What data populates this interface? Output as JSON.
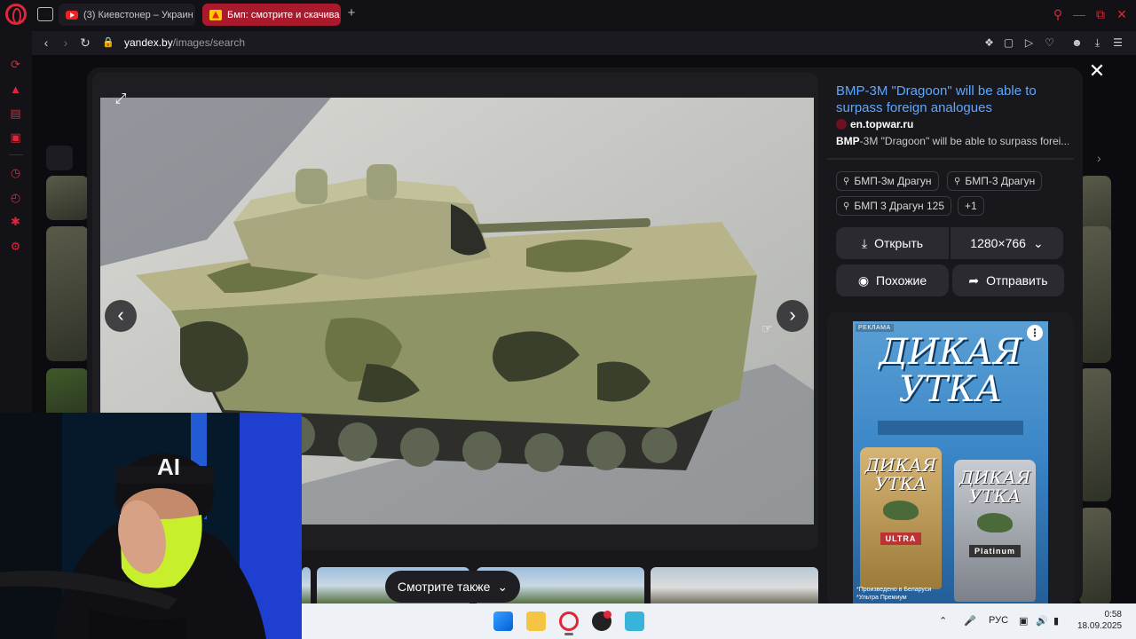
{
  "browser": {
    "tabs": [
      {
        "label": "(3) Киевстонер – Украин",
        "active": false
      },
      {
        "label": "Бмп: смотрите и скачива",
        "active": true
      }
    ],
    "address": {
      "domain": "yandex.by",
      "path": "/images/search"
    }
  },
  "viewer": {
    "title": "BMP-3M \"Dragoon\" will be able to surpass foreign analogues",
    "source": "en.topwar.ru",
    "snippet_bold": "BMP",
    "snippet_rest": "-3M \"Dragoon\" will be able to surpass forei...",
    "chips": [
      "БМП-3м Драгун",
      "БМП-3 Драгун",
      "БМП 3 Драгун 125",
      "+1"
    ],
    "open_label": "Открыть",
    "size_label": "1280×766",
    "similar_label": "Похожие",
    "share_label": "Отправить",
    "see_also_label": "Смотрите также"
  },
  "ad": {
    "badge": "РЕКЛАМА",
    "title_line1": "ДИКАЯ",
    "title_line2": "УТКА",
    "bottle1_line1": "ДИКАЯ",
    "bottle1_line2": "УТКА",
    "bottle1_sub": "ULTRA",
    "bottle2_line1": "ДИКАЯ",
    "bottle2_line2": "УТКА",
    "bottle2_sub": "Platinum",
    "footnote1": "*Произведено в Беларуси",
    "footnote2": "*Ультра Премиум"
  },
  "taskbar": {
    "language": "РУС",
    "time": "0:58",
    "date": "18.09.2025"
  },
  "colors": {
    "accent": "#e0263a",
    "link": "#5ea7ff",
    "active_tab": "#a91b2c"
  }
}
